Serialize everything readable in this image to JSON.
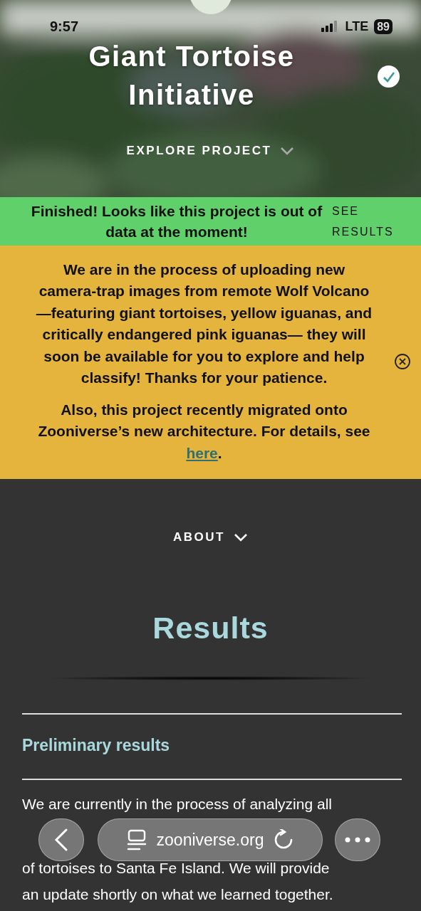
{
  "status_bar": {
    "time": "9:57",
    "network": "LTE",
    "battery": "89"
  },
  "hero": {
    "title": "Giant Tortoise Initiative",
    "verified": true,
    "explore": "EXPLORE PROJECT"
  },
  "finished_banner": {
    "message": "Finished! Looks like this project is out of data at the moment!",
    "link": "SEE RESULTS"
  },
  "announcement": {
    "paragraph": "We are in the process of uploading new camera-trap images from remote Wolf Volcano—featuring giant tortoises, yellow iguanas, and critically endangered pink iguanas— they will soon be available for you to explore and help classify! Thanks for your patience.",
    "note": {
      "before": "Also, this project recently migrated onto Zooniverse’s new architecture. For details, see",
      "link": "here",
      "after": "."
    }
  },
  "about": "ABOUT",
  "results": {
    "title": "Results",
    "section": "Preliminary results",
    "paragraph_lines": [
      "We are currently in the process of analyzing all",
      "of tortoises to Santa Fe Island. We will provide",
      "an update shortly on what we learned together."
    ]
  },
  "browser": {
    "url": "zooniverse.org"
  }
}
